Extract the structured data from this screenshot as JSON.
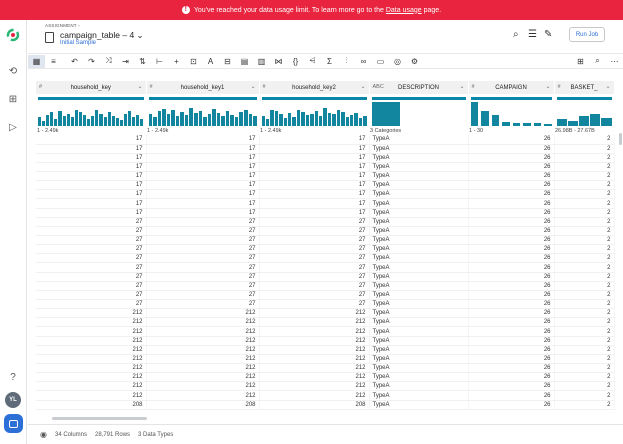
{
  "banner": {
    "text_before": "You've reached your data usage limit. To learn more go to the ",
    "link": "Data usage",
    "text_after": " page."
  },
  "header": {
    "assignment_label": "ASSIGNMENT ›",
    "title": "campaign_table – 4 ⌄",
    "sample": "Initial Sample",
    "run_job": "Run Job"
  },
  "columns": [
    {
      "type": "#",
      "name": "household_key",
      "summary": "1 - 2.49k",
      "width": 110
    },
    {
      "type": "#",
      "name": "household_key1",
      "summary": "1 - 2.49k",
      "width": 113
    },
    {
      "type": "#",
      "name": "household_key2",
      "summary": "1 - 2.49k",
      "width": 110
    },
    {
      "type": "ABC",
      "name": "DESCRIPTION",
      "summary": "3 Categories",
      "width": 99
    },
    {
      "type": "#",
      "name": "CAMPAIGN",
      "summary": "1 - 30",
      "width": 86
    },
    {
      "type": "#",
      "name": "BASKET_",
      "summary": "26.98B - 27.67B",
      "width": 60
    }
  ],
  "rows": [
    [
      "17",
      "17",
      "17",
      "TypeA",
      "26",
      "2"
    ],
    [
      "17",
      "17",
      "17",
      "TypeA",
      "26",
      "2"
    ],
    [
      "17",
      "17",
      "17",
      "TypeA",
      "26",
      "2"
    ],
    [
      "17",
      "17",
      "17",
      "TypeA",
      "26",
      "2"
    ],
    [
      "17",
      "17",
      "17",
      "TypeA",
      "26",
      "2"
    ],
    [
      "17",
      "17",
      "17",
      "TypeA",
      "26",
      "2"
    ],
    [
      "17",
      "17",
      "17",
      "TypeA",
      "26",
      "2"
    ],
    [
      "17",
      "17",
      "17",
      "TypeA",
      "26",
      "2"
    ],
    [
      "17",
      "17",
      "17",
      "TypeA",
      "26",
      "2"
    ],
    [
      "27",
      "27",
      "27",
      "TypeA",
      "26",
      "2"
    ],
    [
      "27",
      "27",
      "27",
      "TypeA",
      "26",
      "2"
    ],
    [
      "27",
      "27",
      "27",
      "TypeA",
      "26",
      "2"
    ],
    [
      "27",
      "27",
      "27",
      "TypeA",
      "26",
      "2"
    ],
    [
      "27",
      "27",
      "27",
      "TypeA",
      "26",
      "2"
    ],
    [
      "27",
      "27",
      "27",
      "TypeA",
      "26",
      "2"
    ],
    [
      "27",
      "27",
      "27",
      "TypeA",
      "26",
      "2"
    ],
    [
      "27",
      "27",
      "27",
      "TypeA",
      "26",
      "2"
    ],
    [
      "27",
      "27",
      "27",
      "TypeA",
      "26",
      "2"
    ],
    [
      "27",
      "27",
      "27",
      "TypeA",
      "26",
      "2"
    ],
    [
      "212",
      "212",
      "212",
      "TypeA",
      "26",
      "2"
    ],
    [
      "212",
      "212",
      "212",
      "TypeA",
      "26",
      "2"
    ],
    [
      "212",
      "212",
      "212",
      "TypeA",
      "26",
      "2"
    ],
    [
      "212",
      "212",
      "212",
      "TypeA",
      "26",
      "2"
    ],
    [
      "212",
      "212",
      "212",
      "TypeA",
      "26",
      "2"
    ],
    [
      "212",
      "212",
      "212",
      "TypeA",
      "26",
      "2"
    ],
    [
      "212",
      "212",
      "212",
      "TypeA",
      "26",
      "2"
    ],
    [
      "212",
      "212",
      "212",
      "TypeA",
      "26",
      "2"
    ],
    [
      "212",
      "212",
      "212",
      "TypeA",
      "26",
      "2"
    ],
    [
      "212",
      "212",
      "212",
      "TypeA",
      "26",
      "2"
    ],
    [
      "208",
      "208",
      "208",
      "TypeA",
      "26",
      "2"
    ]
  ],
  "footer": {
    "columns": "34 Columns",
    "rows": "28,791 Rows",
    "types": "3 Data Types"
  },
  "user": {
    "initials": "YL"
  },
  "colors": {
    "banner": "#e8243f",
    "accent": "#2c6fd6",
    "histogram": "#12869f"
  }
}
